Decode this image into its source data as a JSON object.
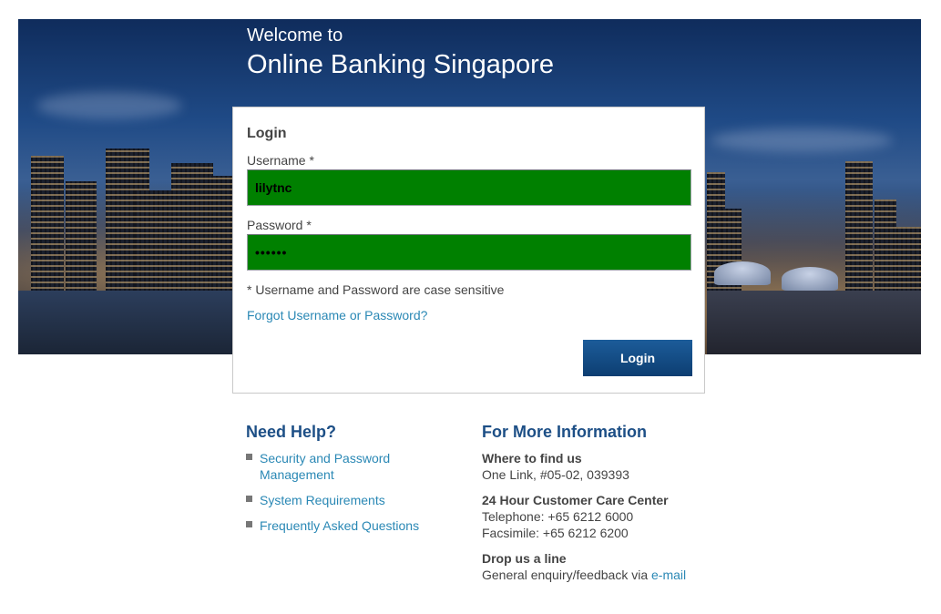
{
  "hero": {
    "subtitle": "Welcome to",
    "title": "Online Banking Singapore"
  },
  "login": {
    "heading": "Login",
    "username_label": "Username *",
    "username_value": "lilytnc",
    "password_label": "Password *",
    "password_value": "••••••",
    "case_note": "* Username and Password are case sensitive",
    "forgot_link": "Forgot Username or Password?",
    "submit_label": "Login"
  },
  "help": {
    "title": "Need Help?",
    "links": [
      "Security and Password Management",
      "System Requirements",
      "Frequently Asked Questions"
    ]
  },
  "info": {
    "title": "For More Information",
    "find_us": {
      "heading": "Where to find us",
      "address": "One Link, #05-02, 039393"
    },
    "care_center": {
      "heading": "24 Hour Customer Care Center",
      "telephone": "Telephone: +65 6212 6000",
      "facsimile": "Facsimile: +65 6212 6200"
    },
    "drop_line": {
      "heading": "Drop us a line",
      "text": "General enquiry/feedback via",
      "email_link": "e-mail"
    }
  },
  "colors": {
    "field_background": "#008000",
    "link": "#2a88b5",
    "section_title": "#1d4f86",
    "button": "#0d3e72"
  }
}
